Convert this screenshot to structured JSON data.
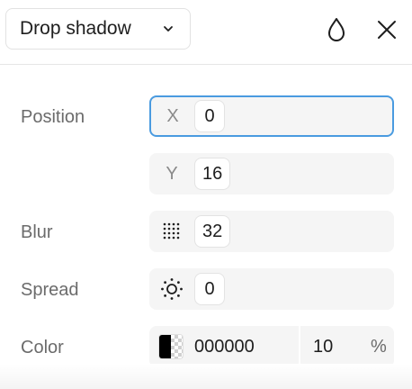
{
  "header": {
    "type_select_value": "Drop shadow"
  },
  "rows": {
    "position": {
      "label": "Position",
      "x_prefix": "X",
      "x_value": "0",
      "y_prefix": "Y",
      "y_value": "16"
    },
    "blur": {
      "label": "Blur",
      "value": "32"
    },
    "spread": {
      "label": "Spread",
      "value": "0"
    },
    "color": {
      "label": "Color",
      "hex": "000000",
      "opacity": "10",
      "opacity_unit": "%"
    }
  },
  "colors": {
    "focus_ring": "#4a9be0",
    "field_bg": "#f5f5f5",
    "swatch": "#000000"
  },
  "icons": [
    "chevron-down-icon",
    "drop-icon",
    "close-icon",
    "blur-grid-icon",
    "spread-sun-icon"
  ]
}
